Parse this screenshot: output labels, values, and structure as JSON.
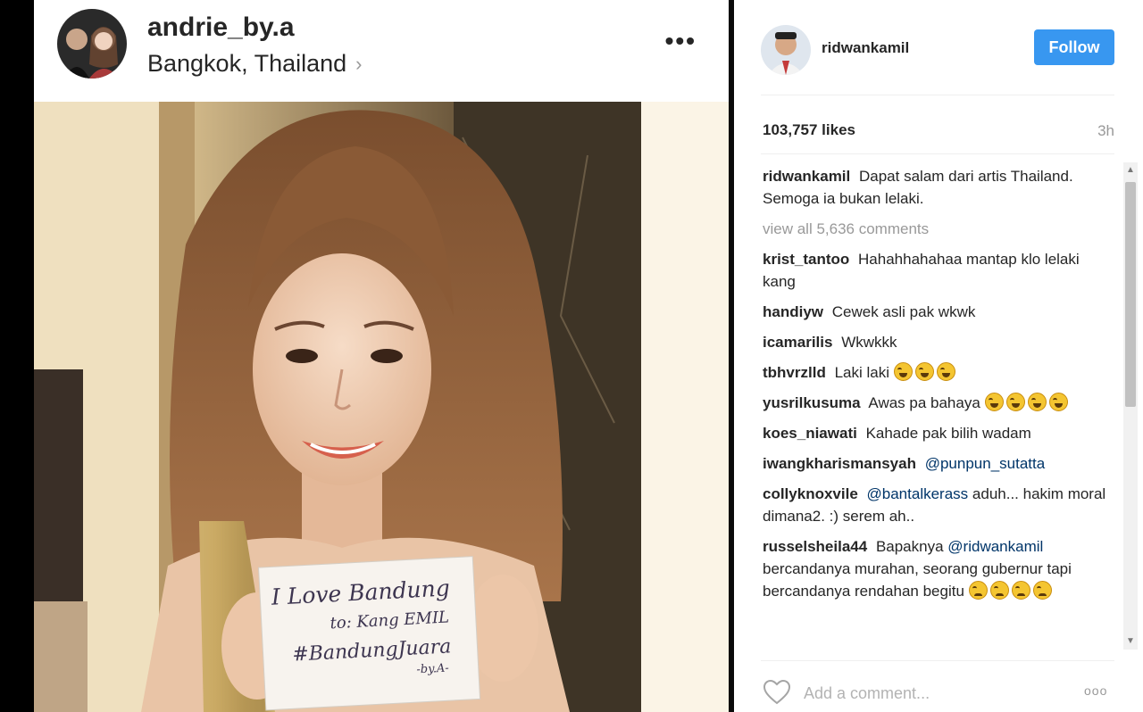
{
  "left_post": {
    "username": "andrie_by.a",
    "location": "Bangkok, Thailand",
    "location_chevron": "›",
    "more_icon": "•••",
    "sign": {
      "line1": "I Love Bandung",
      "line2": "to: Kang EMIL",
      "line3": "#BandungJuara",
      "line4": "-by.A-"
    }
  },
  "right_panel": {
    "username": "ridwankamil",
    "follow_label": "Follow",
    "likes": "103,757 likes",
    "time": "3h",
    "caption": {
      "user": "ridwankamil",
      "text": "Dapat salam dari artis Thailand. Semoga ia bukan lelaki."
    },
    "view_all": "view all 5,636 comments",
    "comments": [
      {
        "user": "krist_tantoo",
        "text": "Hahahhahahaa mantap klo lelaki kang"
      },
      {
        "user": "handiyw",
        "text": "Cewek asli pak wkwk"
      },
      {
        "user": "icamarilis",
        "text": "Wkwkkk"
      },
      {
        "user": "tbhvrzlld",
        "text": "Laki laki"
      },
      {
        "user": "yusrilkusuma",
        "text": "Awas pa bahaya"
      },
      {
        "user": "koes_niawati",
        "text": "Kahade pak bilih wadam"
      },
      {
        "user": "iwangkharismansyah",
        "text": "",
        "mention": "@punpun_sutatta"
      },
      {
        "user": "collyknoxvile",
        "text_after": "aduh... hakim moral dimana2. :) serem ah..",
        "mention": "@bantalkerass"
      },
      {
        "user": "russelsheila44",
        "text": "Bapaknya",
        "mention": "@ridwankamil",
        "text_after": "bercandanya murahan, seorang gubernur tapi bercandanya rendahan begitu"
      }
    ],
    "add_comment_placeholder": "Add a comment...",
    "more_icon": "ooo",
    "accent_color": "#3897f0",
    "icons": [
      "heart-icon",
      "more-icon",
      "scroll-up-icon",
      "scroll-down-icon"
    ]
  }
}
